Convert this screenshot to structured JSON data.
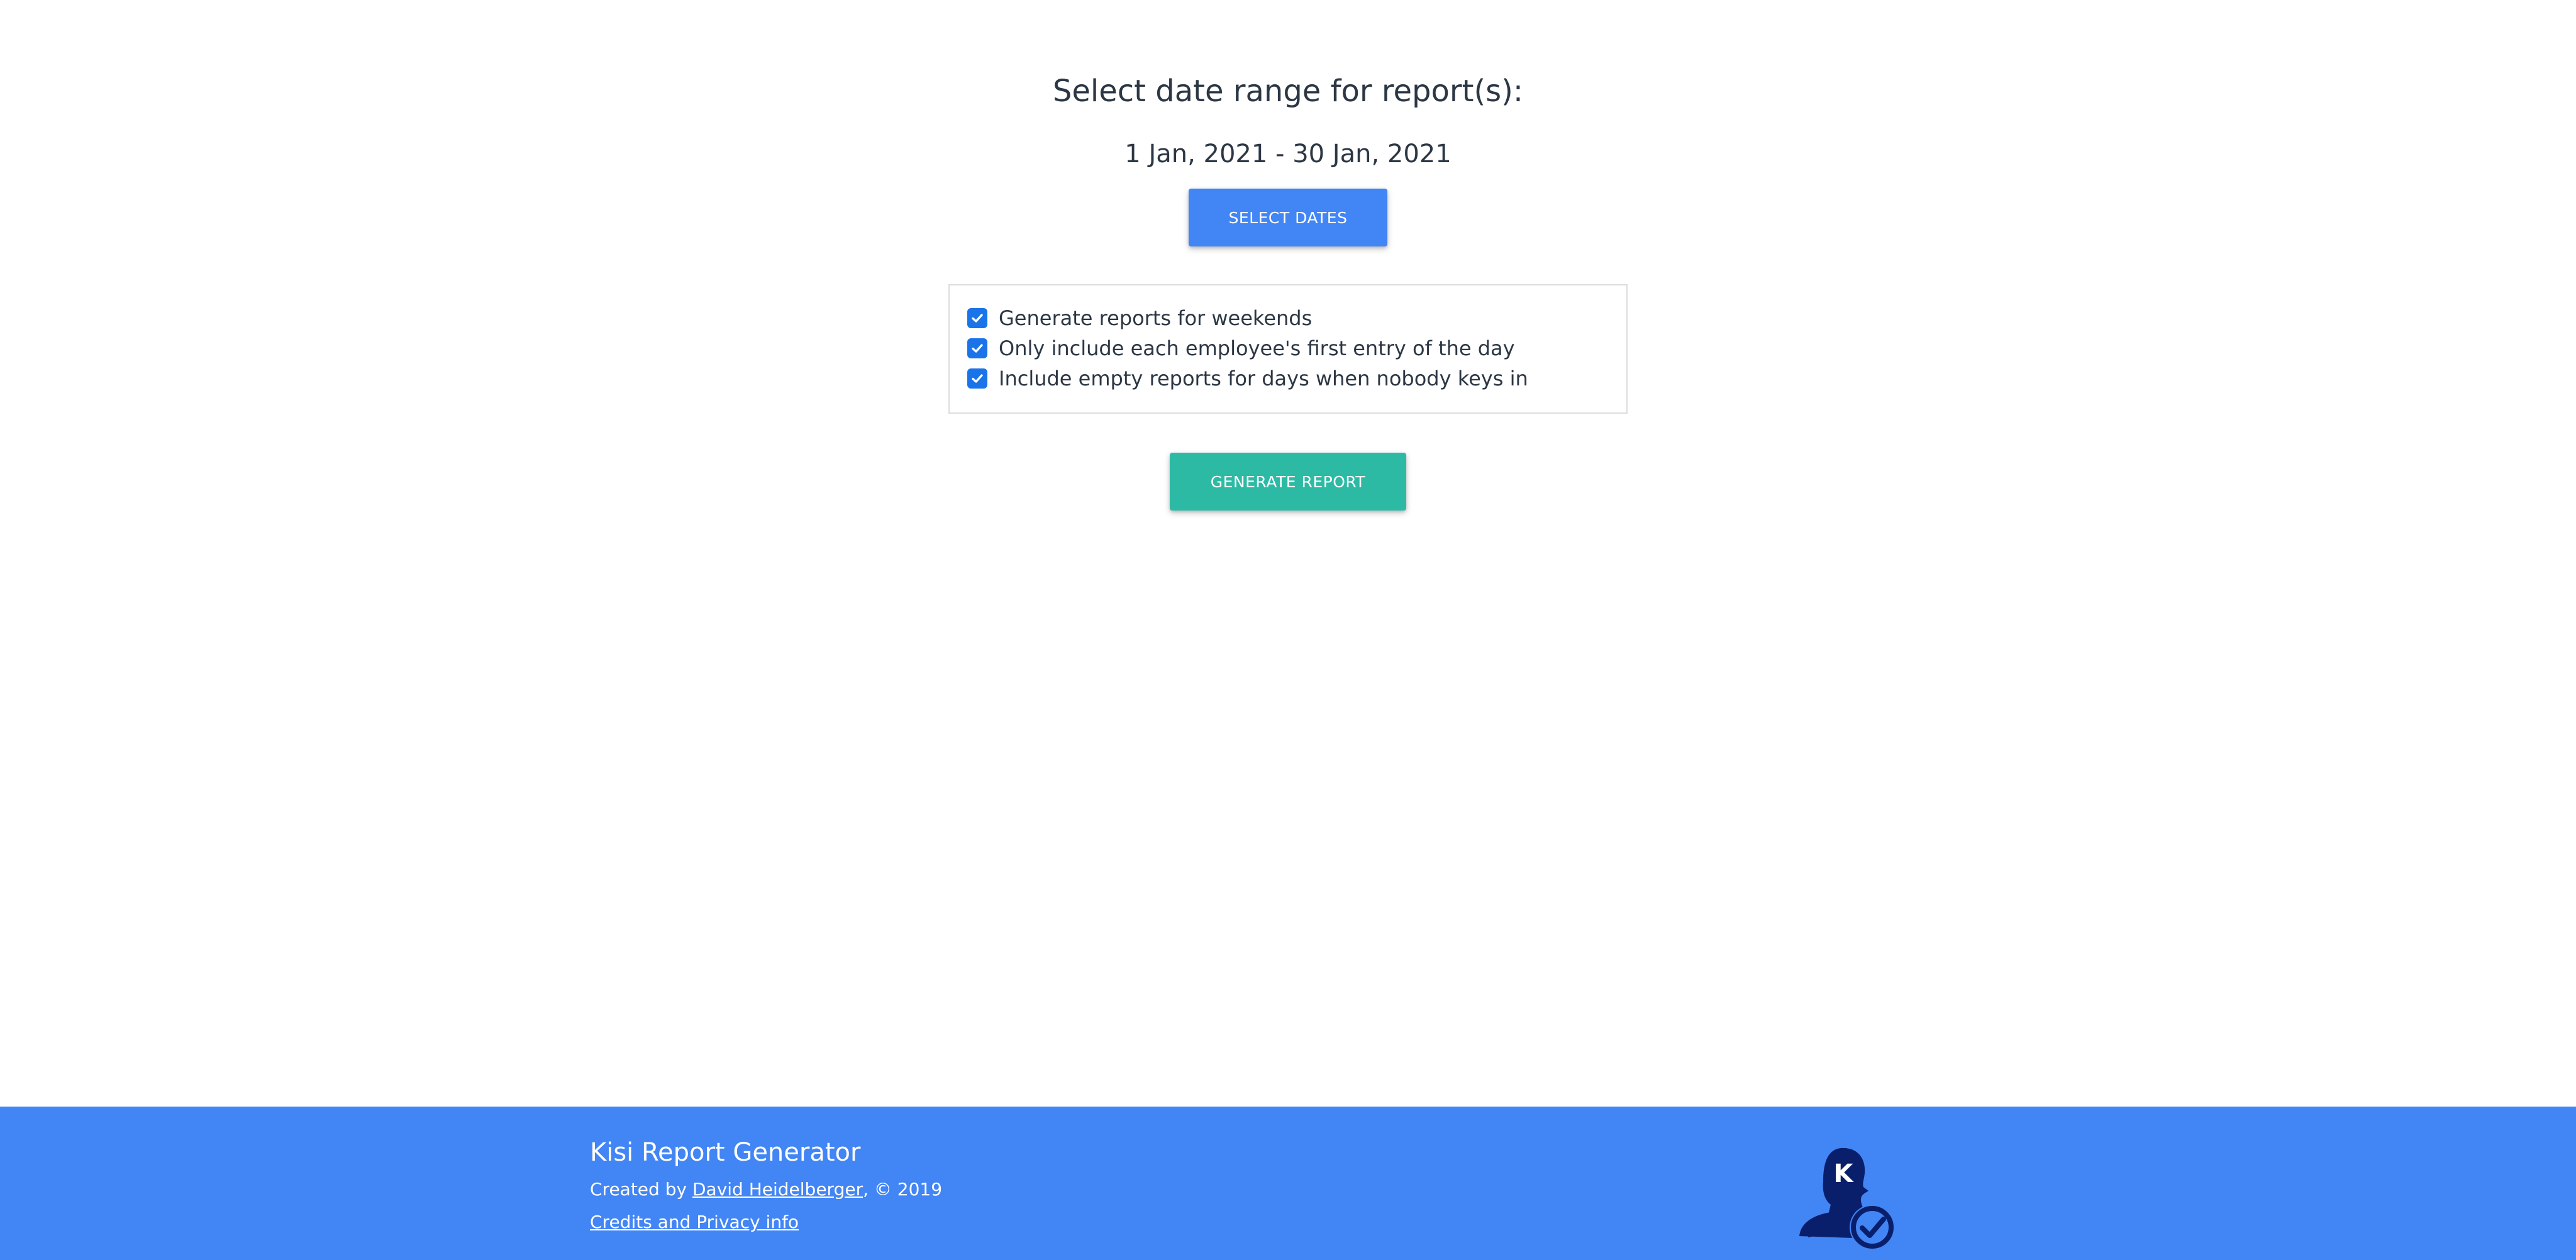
{
  "main": {
    "heading": "Select date range for report(s):",
    "date_range": "1 Jan, 2021 - 30 Jan, 2021",
    "select_dates_label": "SELECT DATES",
    "options": [
      {
        "label": "Generate reports for weekends",
        "checked": true
      },
      {
        "label": "Only include each employee's first entry of the day",
        "checked": true
      },
      {
        "label": "Include empty reports for days when nobody keys in",
        "checked": true
      }
    ],
    "generate_label": "GENERATE REPORT"
  },
  "footer": {
    "title": "Kisi Report Generator",
    "created_by_prefix": "Created by ",
    "author": "David Heidelberger",
    "created_by_suffix": ", © 2019",
    "credits_link": "Credits and Privacy info",
    "logo_letter": "K"
  },
  "colors": {
    "primary_blue": "#4285f4",
    "teal": "#2dbaa5",
    "checkbox_blue": "#1a73e8",
    "logo_navy": "#0a1f6b",
    "text_dark": "#2c3745"
  },
  "icons": {
    "checkbox": "checkbox-checked-icon",
    "logo": "kisi-user-check-logo-icon"
  }
}
